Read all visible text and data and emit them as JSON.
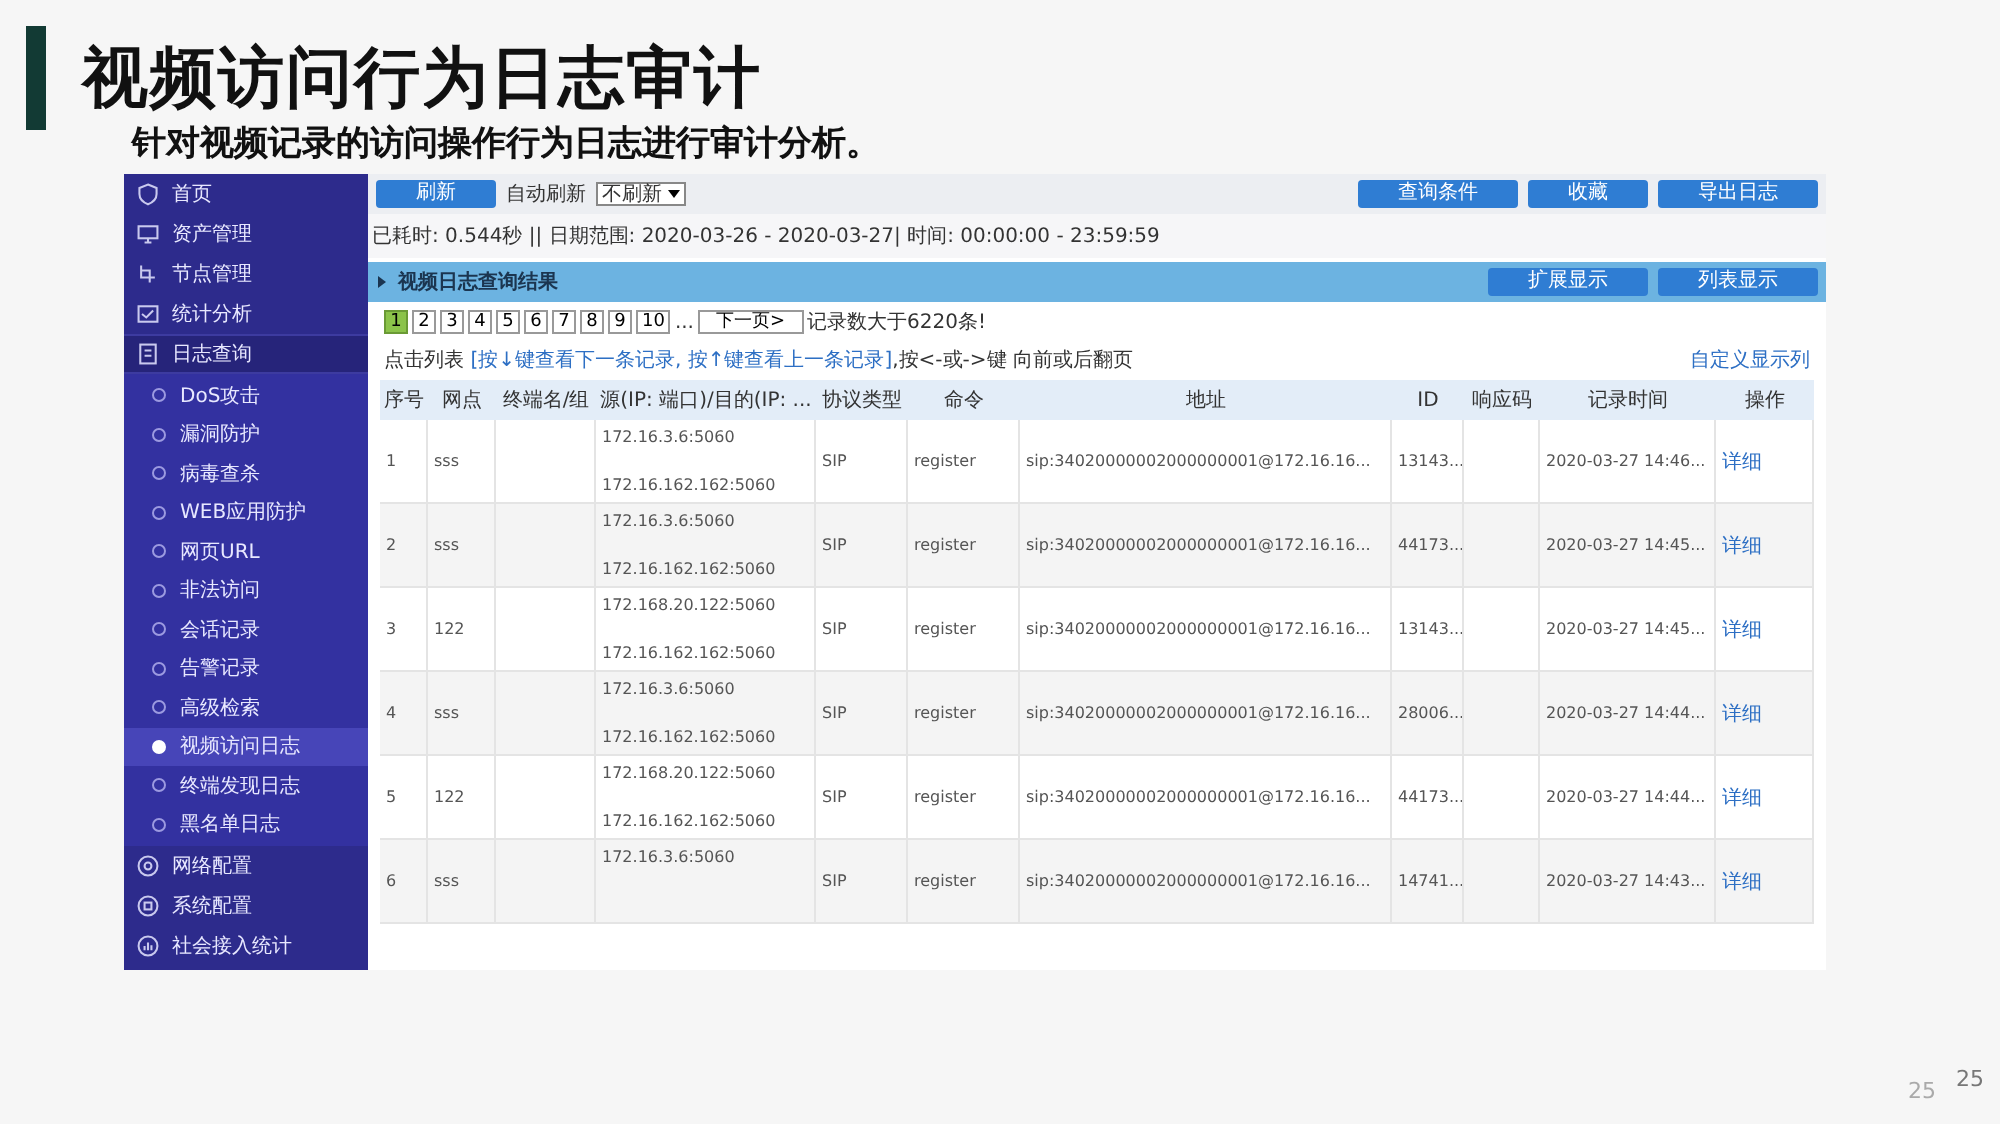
{
  "slide": {
    "title": "视频访问行为日志审计",
    "subtitle": "针对视频记录的访问操作行为日志进行审计分析。",
    "page_numbers": [
      "25",
      "25"
    ]
  },
  "sidebar": {
    "items": [
      {
        "label": "首页",
        "expanded": false
      },
      {
        "label": "资产管理",
        "expanded": false
      },
      {
        "label": "节点管理",
        "expanded": false
      },
      {
        "label": "统计分析",
        "expanded": false
      },
      {
        "label": "日志查询",
        "expanded": true,
        "children": [
          {
            "label": "DoS攻击",
            "selected": false
          },
          {
            "label": "漏洞防护",
            "selected": false
          },
          {
            "label": "病毒查杀",
            "selected": false
          },
          {
            "label": "WEB应用防护",
            "selected": false
          },
          {
            "label": "网页URL",
            "selected": false
          },
          {
            "label": "非法访问",
            "selected": false
          },
          {
            "label": "会话记录",
            "selected": false
          },
          {
            "label": "告警记录",
            "selected": false
          },
          {
            "label": "高级检索",
            "selected": false
          },
          {
            "label": "视频访问日志",
            "selected": true
          },
          {
            "label": "终端发现日志",
            "selected": false
          },
          {
            "label": "黑名单日志",
            "selected": false
          }
        ]
      },
      {
        "label": "网络配置",
        "expanded": false
      },
      {
        "label": "系统配置",
        "expanded": false
      },
      {
        "label": "社会接入统计",
        "expanded": false
      }
    ]
  },
  "toolbar": {
    "refresh_button": "刷新",
    "auto_refresh_label": "自动刷新",
    "auto_refresh_value": "不刷新",
    "buttons": [
      "查询条件",
      "收藏",
      "导出日志"
    ]
  },
  "info_line": "已耗时: 0.544秒 || 日期范围: 2020-03-26 - 2020-03-27| 时间: 00:00:00 - 23:59:59",
  "panel": {
    "title": "视频日志查询结果",
    "buttons": [
      "扩展显示",
      "列表显示"
    ],
    "pages": [
      {
        "label": "1",
        "selected": true
      },
      {
        "label": "2",
        "selected": false
      },
      {
        "label": "3",
        "selected": false
      },
      {
        "label": "4",
        "selected": false
      },
      {
        "label": "5",
        "selected": false
      },
      {
        "label": "6",
        "selected": false
      },
      {
        "label": "7",
        "selected": false
      },
      {
        "label": "8",
        "selected": false
      },
      {
        "label": "9",
        "selected": false
      },
      {
        "label": "10",
        "selected": false
      }
    ],
    "ellipsis": "...",
    "next_button": "下一页>",
    "record_count": "记录数大于6220条!",
    "hint_prefix": "点击列表 ",
    "hint_link": "[按↓键查看下一条记录, 按↑键查看上一条记录]",
    "hint_suffix": ",按<-或->键 向前或后翻页",
    "custom_columns_link": "自定义显示列"
  },
  "table": {
    "columns": [
      "序号",
      "网点",
      "终端名/组",
      "源(IP: 端口)/目的(IP: ...",
      "协议类型",
      "命令",
      "地址",
      "ID",
      "响应码",
      "记录时间",
      "操作"
    ],
    "rows": [
      {
        "no": "1",
        "site": "sss",
        "terminal": "",
        "src": "172.16.3.6:5060",
        "dst": "172.16.162.162:5060",
        "protocol": "SIP",
        "command": "register",
        "address": "sip:34020000002000000001@172.16.16...",
        "id": "13143...",
        "code": "",
        "time": "2020-03-27 14:46...",
        "action": "详细"
      },
      {
        "no": "2",
        "site": "sss",
        "terminal": "",
        "src": "172.16.3.6:5060",
        "dst": "172.16.162.162:5060",
        "protocol": "SIP",
        "command": "register",
        "address": "sip:34020000002000000001@172.16.16...",
        "id": "44173...",
        "code": "",
        "time": "2020-03-27 14:45...",
        "action": "详细"
      },
      {
        "no": "3",
        "site": "122",
        "terminal": "",
        "src": "172.168.20.122:5060",
        "dst": "172.16.162.162:5060",
        "protocol": "SIP",
        "command": "register",
        "address": "sip:34020000002000000001@172.16.16...",
        "id": "13143...",
        "code": "",
        "time": "2020-03-27 14:45...",
        "action": "详细"
      },
      {
        "no": "4",
        "site": "sss",
        "terminal": "",
        "src": "172.16.3.6:5060",
        "dst": "172.16.162.162:5060",
        "protocol": "SIP",
        "command": "register",
        "address": "sip:34020000002000000001@172.16.16...",
        "id": "28006...",
        "code": "",
        "time": "2020-03-27 14:44...",
        "action": "详细"
      },
      {
        "no": "5",
        "site": "122",
        "terminal": "",
        "src": "172.168.20.122:5060",
        "dst": "172.16.162.162:5060",
        "protocol": "SIP",
        "command": "register",
        "address": "sip:34020000002000000001@172.16.16...",
        "id": "44173...",
        "code": "",
        "time": "2020-03-27 14:44...",
        "action": "详细"
      },
      {
        "no": "6",
        "site": "sss",
        "terminal": "",
        "src": "172.16.3.6:5060",
        "dst": "",
        "protocol": "SIP",
        "command": "register",
        "address": "sip:34020000002000000001@172.16.16...",
        "id": "14741...",
        "code": "",
        "time": "2020-03-27 14:43...",
        "action": "详细"
      }
    ]
  }
}
